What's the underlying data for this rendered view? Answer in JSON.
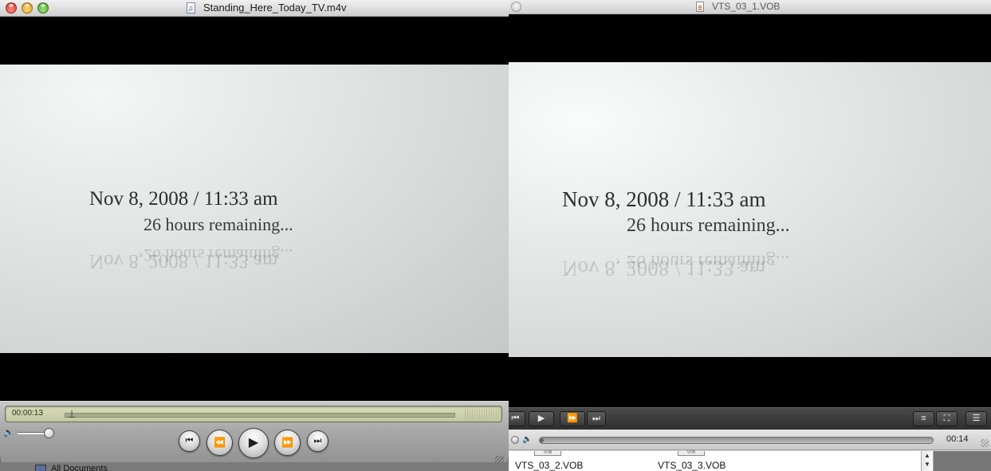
{
  "left_window": {
    "title": "Standing_Here_Today_TV.m4v",
    "frame": {
      "line1": "Nov 8, 2008 / 11:33 am",
      "line2": "26 hours remaining..."
    },
    "controller": {
      "timecode": "00:00:13",
      "buttons": {
        "go_to_start": "⏮",
        "rewind": "⏪",
        "play": "▶",
        "fast_forward": "⏩",
        "go_to_end": "⏭"
      },
      "volume_icon": "🔈"
    },
    "behind_text": "All Documents"
  },
  "right_window": {
    "title": "VTS_03_1.VOB",
    "frame": {
      "line1": "Nov 8, 2008 / 11:33 am",
      "line2": "26 hours remaining..."
    },
    "controller": {
      "buttons": {
        "previous": "⏮",
        "play": "▶",
        "fast_forward": "⏩",
        "next": "⏭",
        "equalizer": "≡",
        "fullscreen": "⛶",
        "chapters": "☰"
      },
      "time": "00:14",
      "volume_icon": "🔈"
    },
    "files": [
      "VTS_03_2.VOB",
      "VTS_03_3.VOB"
    ],
    "file_chip_label": "VOB"
  },
  "colors": {
    "lcd": "#d8dcb8",
    "close": "#d02a1d",
    "minimize": "#d8900c",
    "zoom": "#3b9a1e",
    "video_bg": "#000000"
  },
  "icons": {
    "left_title_icon": "movie-file-icon",
    "right_title_icon": "vob-file-icon"
  }
}
